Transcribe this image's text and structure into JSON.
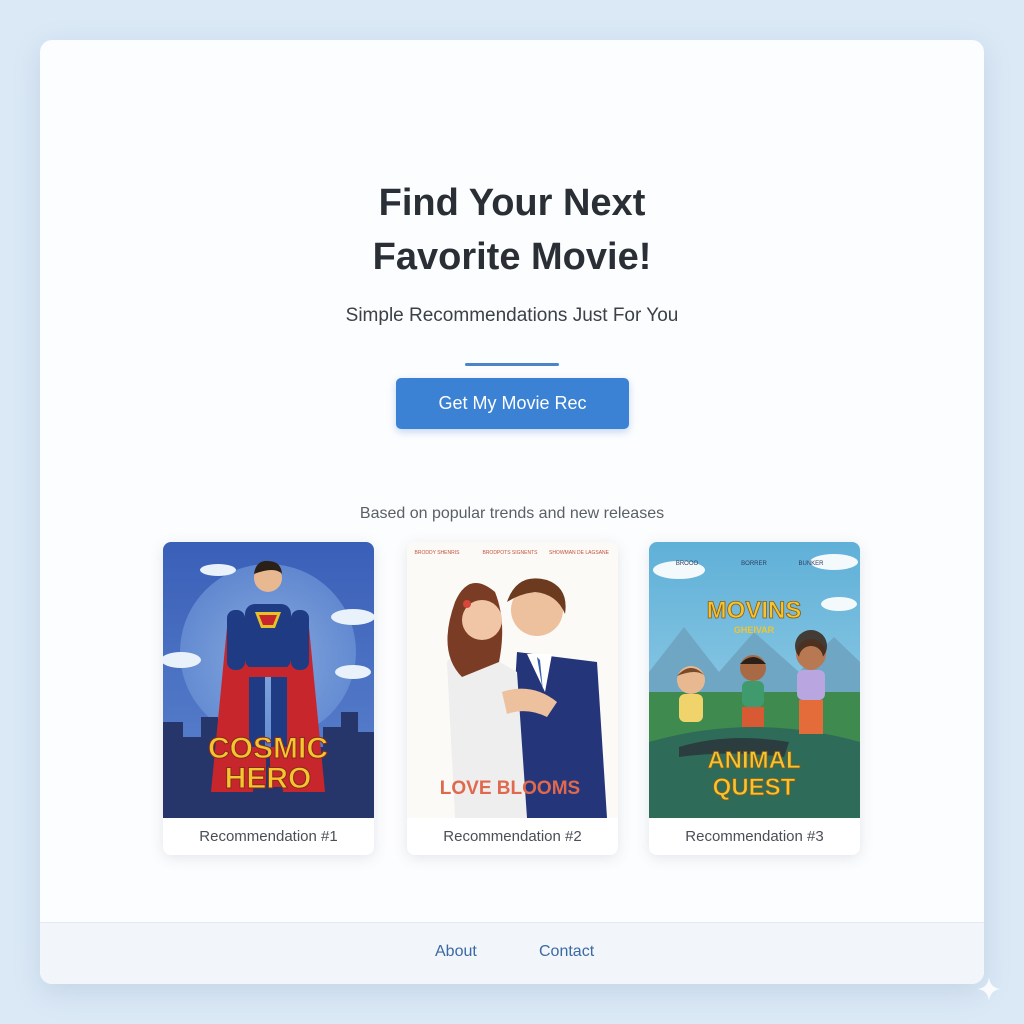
{
  "hero": {
    "title_line1": "Find Your Next",
    "title_line2": "Favorite Movie!",
    "subtitle": "Simple Recommendations Just For You"
  },
  "cta": {
    "label": "Get My Movie Rec"
  },
  "note": "Based on popular trends and new releases",
  "recommendations": [
    {
      "caption": "Recommendation #1",
      "poster_title_line1": "COSMIC",
      "poster_title_line2": "HERO"
    },
    {
      "caption": "Recommendation #2",
      "poster_title_line1": "LOVE BLOOMS",
      "poster_credits": [
        "BRODDY SHENRIS",
        "BRODPOTS SIGNENTS",
        "SHOWMAN DE LAGSANE"
      ]
    },
    {
      "caption": "Recommendation #3",
      "poster_title_line1": "ANIMAL",
      "poster_title_line2": "QUEST",
      "poster_top_line1": "MOVINS",
      "poster_top_line2": "GHEIVAR",
      "poster_credits": [
        "BROOO",
        "BORRER",
        "BUNKER"
      ]
    }
  ],
  "footer": {
    "links": [
      "About",
      "Contact"
    ]
  },
  "colors": {
    "background": "#dbe9f6",
    "accent": "#3b82d4",
    "title": "#2a2e35",
    "link": "#3a6aa3"
  },
  "icons": {
    "corner": "sparkle-icon"
  }
}
